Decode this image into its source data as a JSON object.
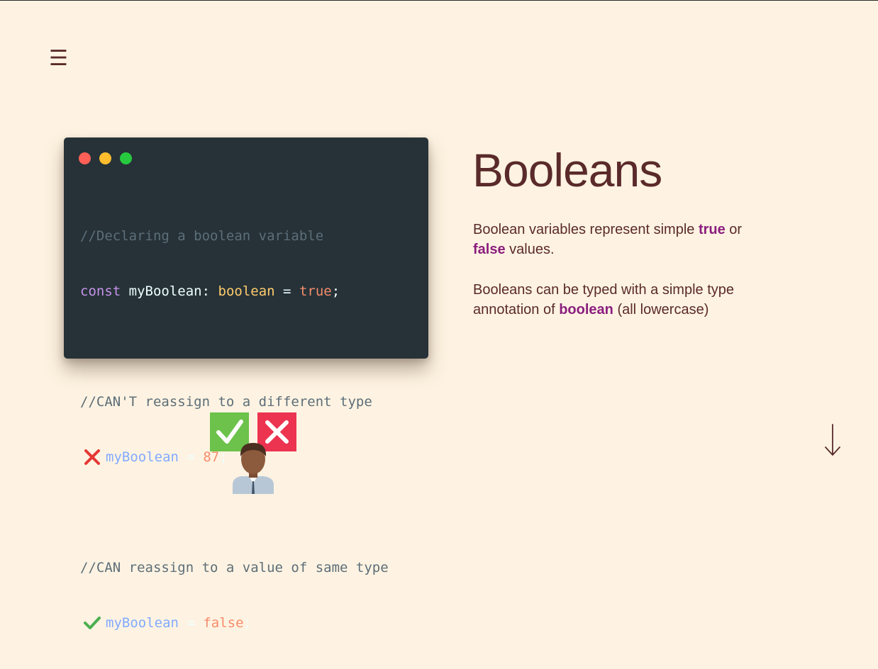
{
  "menu": {
    "icon": "menu-icon",
    "glyph": "☰"
  },
  "code_window": {
    "comment1": "//Declaring a boolean variable",
    "decl_keyword": "const",
    "decl_name": "myBoolean",
    "decl_colon": ":",
    "decl_type": "boolean",
    "decl_eq": "=",
    "decl_value": "true",
    "decl_semi": ";",
    "comment2": "//CAN'T reassign to a different type",
    "bad_var": "myBoolean",
    "bad_eq": "=",
    "bad_value": "87",
    "bad_semi": ";",
    "comment3": "//CAN reassign to a value of same type",
    "good_var": "myBoolean",
    "good_eq": "=",
    "good_value": "false",
    "good_semi": ";",
    "colors": {
      "background": "#263238",
      "comment": "#5d6e78",
      "keyword": "#c792ea",
      "type": "#ffcb6b",
      "value": "#f78c6c",
      "variable": "#82aaff"
    }
  },
  "heading": "Booleans",
  "p1": {
    "before": "Boolean variables represent simple ",
    "kw1": "true",
    "middle": " or ",
    "kw2": "false",
    "after": " values."
  },
  "p2": {
    "before": "Booleans can be typed with a simple type annotation of ",
    "kw": "boolean",
    "after": " (all lowercase)"
  },
  "icons": {
    "menu": "menu-icon",
    "scroll_down": "arrow-down-icon",
    "cross": "red-x-icon",
    "check": "green-check-icon"
  },
  "colors": {
    "page_background": "#fef3e2",
    "text": "#5a2a2a",
    "highlight": "#8b1e7f"
  }
}
